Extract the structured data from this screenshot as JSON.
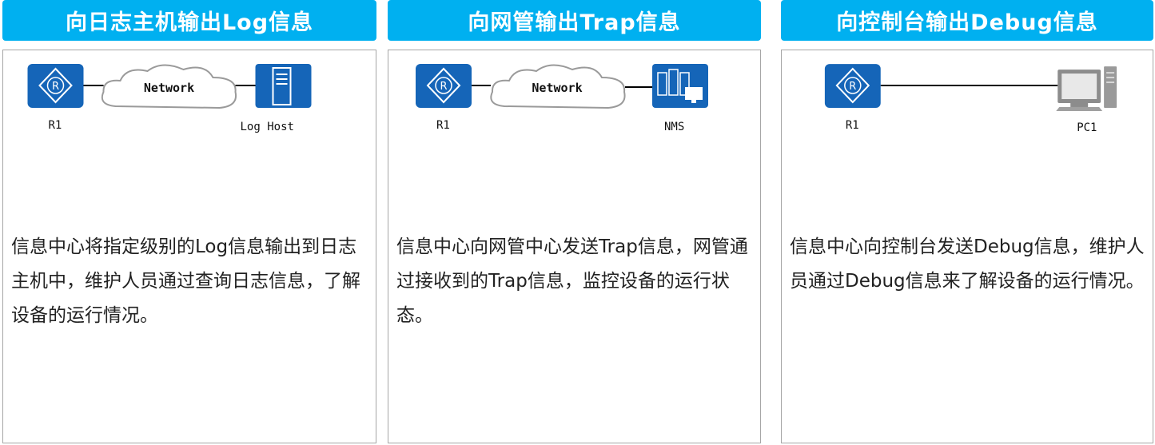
{
  "colors": {
    "header_bg": "#00b0f0",
    "device_blue": "#1565b8",
    "border": "#a6a6a6"
  },
  "panels": [
    {
      "title": "向日志主机输出Log信息",
      "router_label": "R1",
      "cloud_label": "Network",
      "host_label": "Log Host",
      "description": "信息中心将指定级别的Log信息输出到日志主机中，维护人员通过查询日志信息，了解设备的运行情况。"
    },
    {
      "title": "向网管输出Trap信息",
      "router_label": "R1",
      "cloud_label": "Network",
      "host_label": "NMS",
      "description": "信息中心向网管中心发送Trap信息，网管通过接收到的Trap信息，监控设备的运行状态。"
    },
    {
      "title": "向控制台输出Debug信息",
      "router_label": "R1",
      "host_label": "PC1",
      "description": "信息中心向控制台发送Debug信息，维护人员通过Debug信息来了解设备的运行情况。"
    }
  ]
}
